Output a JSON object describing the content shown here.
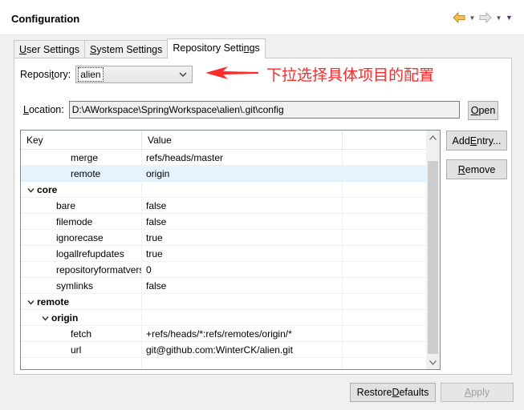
{
  "header": {
    "title": "Configuration",
    "nav": {
      "back_icon": "back-arrow-icon",
      "forward_icon": "forward-arrow-icon",
      "menu_icon": "view-menu-icon"
    }
  },
  "tabs": [
    {
      "label_pre": "",
      "label_u": "U",
      "label_post": "ser Settings"
    },
    {
      "label_pre": "",
      "label_u": "S",
      "label_post": "ystem Settings"
    },
    {
      "label_pre": "Repository Setti",
      "label_u": "n",
      "label_post": "gs"
    }
  ],
  "repository": {
    "label_pre": "Reposi",
    "label_u": "t",
    "label_post": "ory:",
    "selected": "alien"
  },
  "annotation": {
    "text": "下拉选择具体项目的配置",
    "color": "#ff2a2a"
  },
  "location": {
    "label_pre": "",
    "label_u": "L",
    "label_post": "ocation:",
    "value": "D:\\AWorkspace\\SpringWorkspace\\alien\\.git\\config",
    "open_pre": "",
    "open_u": "O",
    "open_post": "pen"
  },
  "table": {
    "columns": [
      "Key",
      "Value",
      ""
    ],
    "rows": [
      {
        "indent": 3,
        "key": "merge",
        "value": "refs/heads/master",
        "group": false,
        "expanded": null,
        "selected": false
      },
      {
        "indent": 3,
        "key": "remote",
        "value": "origin",
        "group": false,
        "expanded": null,
        "selected": true
      },
      {
        "indent": 0,
        "key": "core",
        "value": "",
        "group": true,
        "expanded": true,
        "selected": false
      },
      {
        "indent": 2,
        "key": "bare",
        "value": "false",
        "group": false,
        "expanded": null,
        "selected": false
      },
      {
        "indent": 2,
        "key": "filemode",
        "value": "false",
        "group": false,
        "expanded": null,
        "selected": false
      },
      {
        "indent": 2,
        "key": "ignorecase",
        "value": "true",
        "group": false,
        "expanded": null,
        "selected": false
      },
      {
        "indent": 2,
        "key": "logallrefupdates",
        "value": "true",
        "group": false,
        "expanded": null,
        "selected": false
      },
      {
        "indent": 2,
        "key": "repositoryformatversion",
        "value": "0",
        "group": false,
        "expanded": null,
        "selected": false
      },
      {
        "indent": 2,
        "key": "symlinks",
        "value": "false",
        "group": false,
        "expanded": null,
        "selected": false
      },
      {
        "indent": 0,
        "key": "remote",
        "value": "",
        "group": true,
        "expanded": true,
        "selected": false
      },
      {
        "indent": 1,
        "key": "origin",
        "value": "",
        "group": true,
        "expanded": true,
        "selected": false
      },
      {
        "indent": 3,
        "key": "fetch",
        "value": "+refs/heads/*:refs/remotes/origin/*",
        "group": false,
        "expanded": null,
        "selected": false
      },
      {
        "indent": 3,
        "key": "url",
        "value": "git@github.com:WinterCK/alien.git",
        "group": false,
        "expanded": null,
        "selected": false
      },
      {
        "indent": 0,
        "key": "",
        "value": "",
        "group": false,
        "expanded": null,
        "selected": false
      }
    ]
  },
  "side_buttons": {
    "add_pre": "Add ",
    "add_u": "E",
    "add_post": "ntry...",
    "remove_pre": "",
    "remove_u": "R",
    "remove_post": "emove"
  },
  "footer": {
    "restore_pre": "Restore ",
    "restore_u": "D",
    "restore_post": "efaults",
    "apply_pre": "",
    "apply_u": "A",
    "apply_post": "pply",
    "apply_enabled": false
  },
  "colors": {
    "selection": "#e5f3ff",
    "accent_arrow": "#ff2a2a",
    "back_icon": "#e8a33a"
  }
}
